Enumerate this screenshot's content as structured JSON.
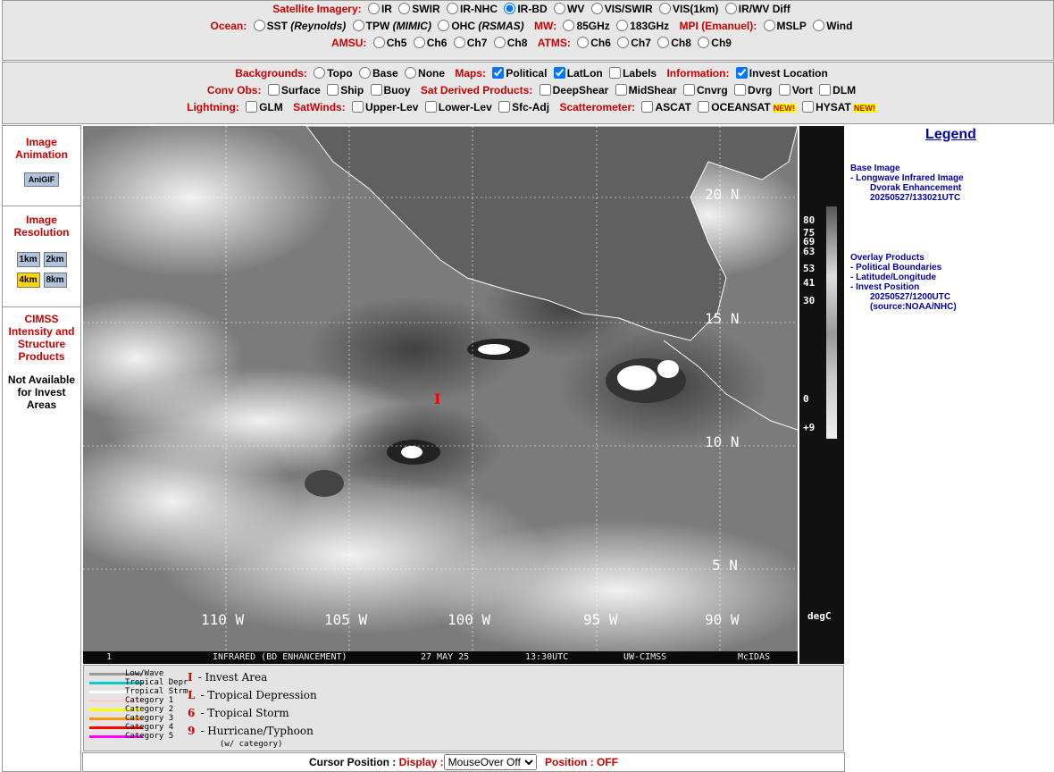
{
  "top": {
    "satellite_label": "Satellite Imagery:",
    "satellite_options": [
      "IR",
      "SWIR",
      "IR-NHC",
      "IR-BD",
      "WV",
      "VIS/SWIR",
      "VIS(1km)",
      "IR/WV Diff"
    ],
    "ocean_label": "Ocean:",
    "ocean_options": [
      {
        "a": "SST",
        "b": "(Reynolds)"
      },
      {
        "a": "TPW",
        "b": "(MIMIC)"
      },
      {
        "a": "OHC",
        "b": "(RSMAS)"
      }
    ],
    "mw_label": "MW:",
    "mw_options": [
      "85GHz",
      "183GHz"
    ],
    "mpi_label": "MPI (Emanuel):",
    "mpi_options": [
      "MSLP",
      "Wind"
    ],
    "amsu_label": "AMSU:",
    "amsu_options": [
      "Ch5",
      "Ch6",
      "Ch7",
      "Ch8"
    ],
    "atms_label": "ATMS:",
    "atms_options": [
      "Ch6",
      "Ch7",
      "Ch8",
      "Ch9"
    ]
  },
  "mid": {
    "backgrounds_label": "Backgrounds:",
    "backgrounds_options": [
      "Topo",
      "Base",
      "None"
    ],
    "maps_label": "Maps:",
    "maps_options": [
      {
        "label": "Political",
        "checked": true
      },
      {
        "label": "LatLon",
        "checked": true
      },
      {
        "label": "Labels",
        "checked": false
      }
    ],
    "info_label": "Information:",
    "info_option": "Invest Location",
    "conv_label": "Conv Obs:",
    "conv_options": [
      "Surface",
      "Ship",
      "Buoy"
    ],
    "sat_derived_label": "Sat Derived Products:",
    "sat_derived_options": [
      "DeepShear",
      "MidShear",
      "Cnvrg",
      "Dvrg",
      "Vort",
      "DLM"
    ],
    "lightning_label": "Lightning:",
    "lightning_option": "GLM",
    "satwinds_label": "SatWinds:",
    "satwinds_options": [
      "Upper-Lev",
      "Lower-Lev",
      "Sfc-Adj"
    ],
    "scatter_label": "Scatterometer:",
    "scatter_options": [
      "ASCAT",
      "OCEANSAT",
      "HYSAT"
    ],
    "new_badge": "NEW!"
  },
  "left": {
    "animation_title": "Image Animation",
    "anigif": "AniGIF",
    "resolution_title": "Image Resolution",
    "resolutions": [
      "1km",
      "2km",
      "4km",
      "8km"
    ],
    "selected_resolution": "4km",
    "cimss_title": "CIMSS Intensity and Structure Products",
    "not_available": "Not Available for Invest Areas"
  },
  "map": {
    "lat_labels": [
      "20 N",
      "15 N",
      "10 N",
      "5 N"
    ],
    "lon_labels": [
      "110 W",
      "105 W",
      "100 W",
      "95 W",
      "90 W"
    ],
    "caption": {
      "num": "1",
      "title": "INFRARED (BD ENHANCEMENT)",
      "date": "27 MAY 25",
      "time": "13:30UTC",
      "org": "UW-CIMSS",
      "sys": "McIDAS"
    }
  },
  "colorbar": {
    "ticks": [
      "80",
      "75",
      "69",
      "63",
      "53",
      "41",
      "30",
      "0",
      "+9"
    ],
    "unit": "degC"
  },
  "legend_panel": {
    "track_items": [
      "Low/Wave",
      "Tropical Depr",
      "Tropical Strm",
      "Category 1",
      "Category 2",
      "Category 3",
      "Category 4",
      "Category 5"
    ],
    "track_colors": [
      "#999999",
      "#00cccc",
      "#ffffff",
      "#ffcccc",
      "#ffff00",
      "#ff9900",
      "#ff0000",
      "#ff00ff"
    ],
    "symbols": [
      "- Invest Area",
      "- Tropical Depression",
      "- Tropical Storm",
      "- Hurricane/Typhoon"
    ],
    "symbol_glyphs": [
      "I",
      "L",
      "6",
      "9"
    ],
    "symbol_note": "(w/ category)"
  },
  "status": {
    "cursor_label": "Cursor Position :",
    "display_label": "Display :",
    "display_value": "MouseOver Off",
    "position_label": "Position : OFF"
  },
  "right": {
    "legend_title": "Legend",
    "base_title": "Base Image",
    "base_line1": "- Longwave Infrared Image",
    "base_line2": "Dvorak Enhancement",
    "base_line3": "20250527/133021UTC",
    "overlay_title": "Overlay Products",
    "overlay_items": [
      "- Political Boundaries",
      "- Latitude/Longitude",
      "- Invest Position"
    ],
    "overlay_line4": "20250527/1200UTC",
    "overlay_line5": "(source:NOAA/NHC)"
  }
}
